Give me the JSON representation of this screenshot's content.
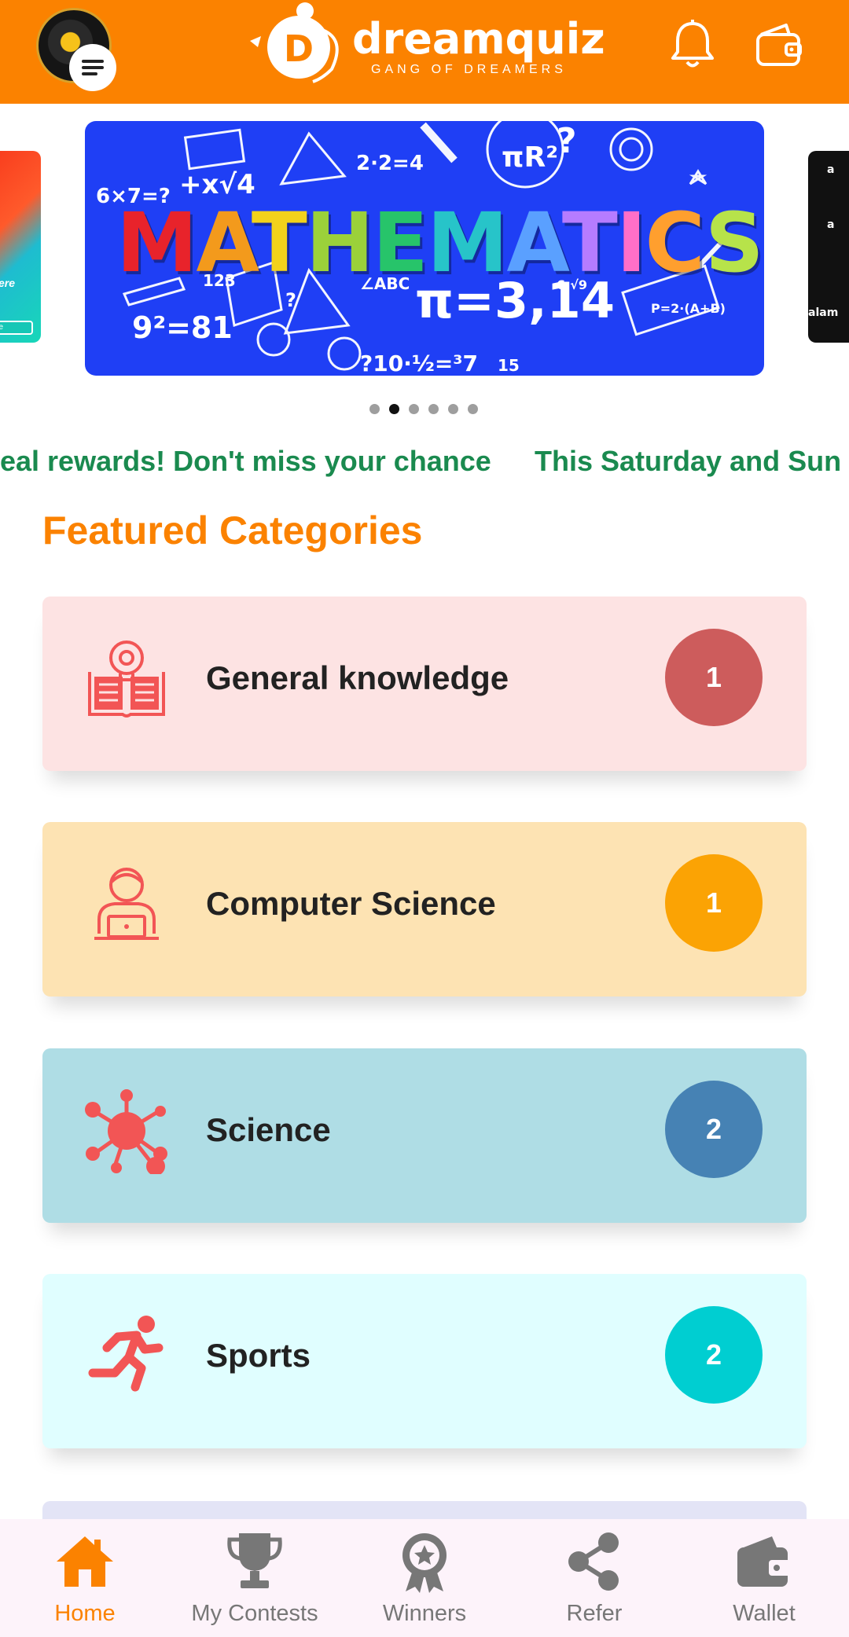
{
  "app": {
    "logo_text": "dreamquiz",
    "logo_tagline": "GANG OF DREAMERS",
    "logo_letter": "D",
    "brand_color": "#fb8200",
    "icons": {
      "menu": "menu-icon",
      "notifications": "bell-icon",
      "wallet": "wallet-icon"
    }
  },
  "carousel": {
    "banner_title": "MATHEMATICS",
    "banner_letters": [
      {
        "ch": "M",
        "color": "#e8232b"
      },
      {
        "ch": "A",
        "color": "#f39a1c"
      },
      {
        "ch": "T",
        "color": "#f2d21b"
      },
      {
        "ch": "H",
        "color": "#9bd13a"
      },
      {
        "ch": "E",
        "color": "#27c46a"
      },
      {
        "ch": "M",
        "color": "#27c4c9"
      },
      {
        "ch": "A",
        "color": "#5aa0ff"
      },
      {
        "ch": "T",
        "color": "#b57cff"
      },
      {
        "ch": "I",
        "color": "#ff6fc8"
      },
      {
        "ch": "C",
        "color": "#ff9f2e"
      },
      {
        "ch": "S",
        "color": "#b7e34a"
      }
    ],
    "side_tag": "ere",
    "side_pill": "e Here",
    "side_right_text": "alam",
    "slide_count": 6,
    "active_slide": 2
  },
  "marquee": {
    "items": [
      "eal rewards! Don't miss your chance",
      "This Saturday and Sun"
    ]
  },
  "section": {
    "title": "Featured Categories"
  },
  "categories": [
    {
      "name": "General knowledge",
      "count": "1",
      "bg": "#fde3e3",
      "badge": "#cd5c5c",
      "icon": "book-bulb-icon"
    },
    {
      "name": "Computer Science",
      "count": "1",
      "bg": "#fde3b3",
      "badge": "#fba304",
      "icon": "person-laptop-icon"
    },
    {
      "name": "Science",
      "count": "2",
      "bg": "#afdde5",
      "badge": "#4682b4",
      "icon": "molecule-icon"
    },
    {
      "name": "Sports",
      "count": "2",
      "bg": "#e0feff",
      "badge": "#00ced1",
      "icon": "running-man-icon"
    }
  ],
  "bottom_nav": [
    {
      "label": "Home",
      "icon": "home-icon",
      "active": true
    },
    {
      "label": "My Contests",
      "icon": "trophy-icon",
      "active": false
    },
    {
      "label": "Winners",
      "icon": "medal-icon",
      "active": false
    },
    {
      "label": "Refer",
      "icon": "share-icon",
      "active": false
    },
    {
      "label": "Wallet",
      "icon": "wallet-icon",
      "active": false
    }
  ]
}
